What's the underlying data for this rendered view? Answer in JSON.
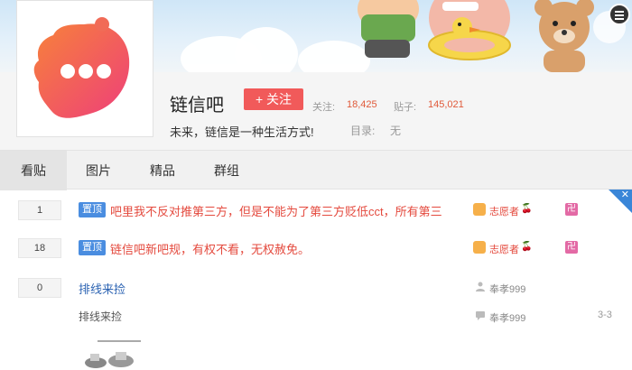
{
  "forum": {
    "name": "链信吧",
    "follow_label": "+ 关注",
    "followers_label": "关注:",
    "followers_value": "18,425",
    "posts_label": "贴子:",
    "posts_value": "145,021",
    "slogan": "未来，链信是一种生活方式!",
    "directory_label": "目录:",
    "directory_value": "无"
  },
  "tabs": [
    {
      "label": "看贴",
      "active": true
    },
    {
      "label": "图片",
      "active": false
    },
    {
      "label": "精品",
      "active": false
    },
    {
      "label": "群组",
      "active": false
    }
  ],
  "threads": [
    {
      "replies": "1",
      "tag": "置顶",
      "title": "吧里我不反对推第三方，但是不能为了第三方贬低cct，所有第三",
      "author": "志愿者",
      "author_badge": "🍒"
    },
    {
      "replies": "18",
      "tag": "置顶",
      "title": "链信吧新吧规，有权不看，无权赦免。",
      "author": "志愿者",
      "author_badge": "🍒"
    },
    {
      "replies": "0",
      "title": "排线来捡",
      "author": "奉孝999",
      "abstract": "排线来捡",
      "last_reply_user": "奉孝999",
      "time": "3-3"
    }
  ],
  "colors": {
    "accent_red": "#f15a5a",
    "title_red": "#e44a3e",
    "link_blue": "#2d64b3",
    "tag_blue": "#4a8de0"
  },
  "icons": {
    "corner": "close-icon",
    "menu": "menu-icon",
    "author": "user-icon",
    "sign": "sign-in-icon"
  }
}
